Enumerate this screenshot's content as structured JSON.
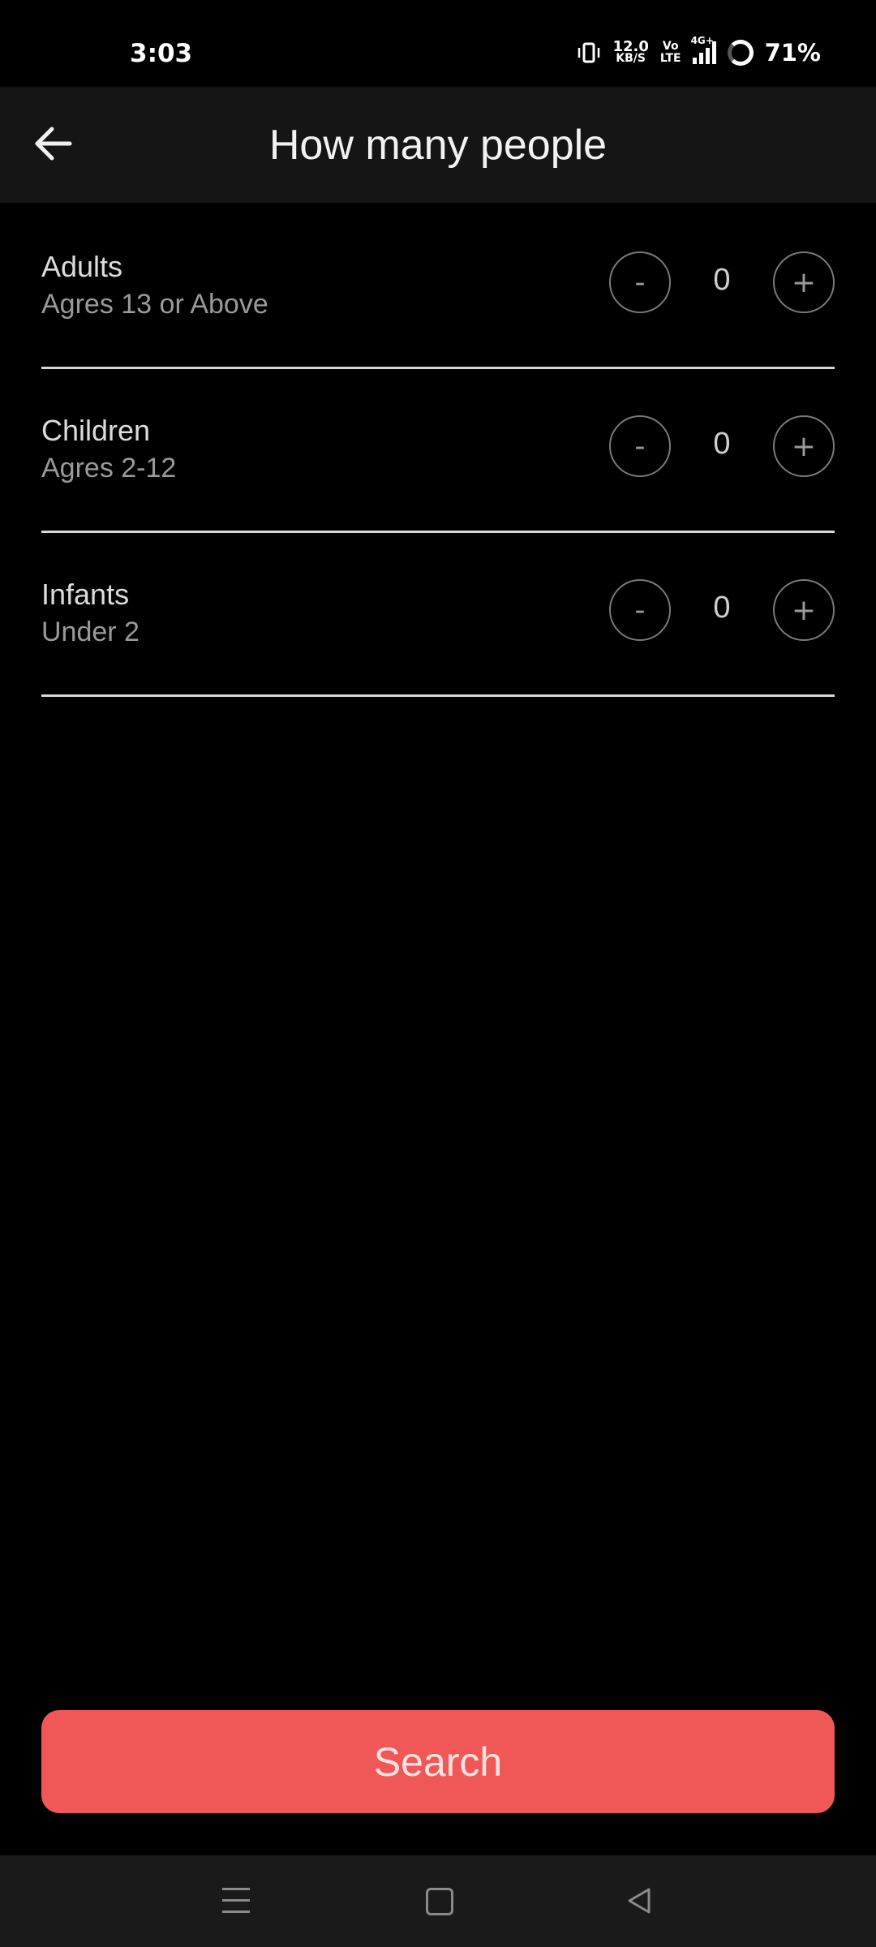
{
  "status_bar": {
    "time": "3:03",
    "data_rate": "12.0",
    "data_rate_unit": "KB/S",
    "volte_top": "Vo",
    "volte_bottom": "LTE",
    "network": "4G+",
    "battery": "71%"
  },
  "header": {
    "title": "How many people",
    "back_icon": "arrow-left-icon"
  },
  "groups": [
    {
      "title": "Adults",
      "subtitle": "Agres 13 or Above",
      "count": "0",
      "minus_label": "-",
      "plus_label": "+"
    },
    {
      "title": "Children",
      "subtitle": "Agres 2-12",
      "count": "0",
      "minus_label": "-",
      "plus_label": "+"
    },
    {
      "title": "Infants",
      "subtitle": "Under 2",
      "count": "0",
      "minus_label": "-",
      "plus_label": "+"
    }
  ],
  "search_button": {
    "label": "Search"
  },
  "colors": {
    "accent": "#f05757",
    "background": "#000000",
    "header_bg": "#151515"
  },
  "nav_bar": {
    "icons": [
      "menu-icon",
      "home-square-icon",
      "back-triangle-icon"
    ]
  }
}
